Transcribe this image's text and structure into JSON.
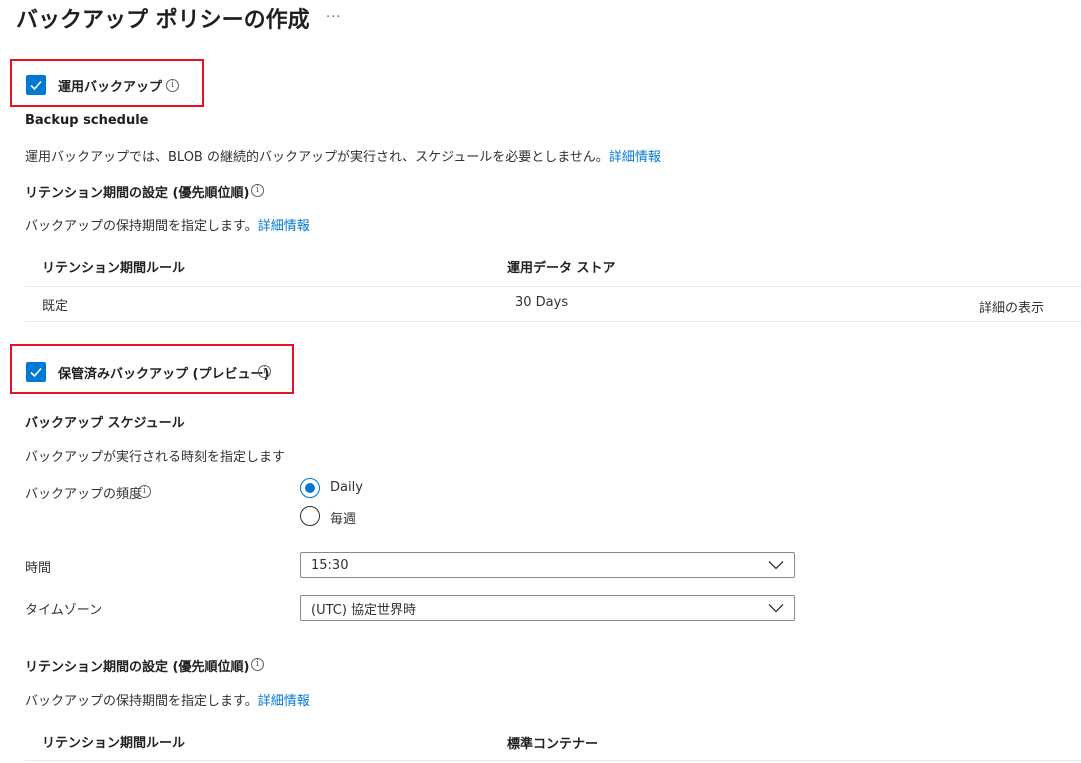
{
  "header": {
    "title": "バックアップ ポリシーの作成",
    "more_label": "···"
  },
  "operational": {
    "checkbox_label": "運用バックアップ",
    "checked": true,
    "schedule_heading": "Backup schedule",
    "schedule_desc": "運用バックアップでは、BLOB の継続的バックアップが実行され、スケジュールを必要としません。",
    "schedule_link": "詳細情報",
    "retention_heading": "リテンション期間の設定 (優先順位順)",
    "retention_desc": "バックアップの保持期間を指定します。",
    "retention_link": "詳細情報",
    "table": {
      "col_rule": "リテンション期間ルール",
      "col_store": "運用データ ストア",
      "rows": [
        {
          "rule": "既定",
          "store": "30 Days",
          "action": "詳細の表示"
        }
      ]
    }
  },
  "vaulted": {
    "checkbox_label": "保管済みバックアップ (プレビュー)",
    "checked": true,
    "schedule_heading": "バックアップ スケジュール",
    "schedule_desc": "バックアップが実行される時刻を指定します",
    "frequency_label": "バックアップの頻度",
    "frequency_options": [
      {
        "label": "Daily",
        "checked": true
      },
      {
        "label": "毎週",
        "checked": false
      }
    ],
    "time_label": "時間",
    "time_value": "15:30",
    "timezone_label": "タイムゾーン",
    "timezone_value": "(UTC) 協定世界時",
    "retention_heading": "リテンション期間の設定 (優先順位順)",
    "retention_desc": "バックアップの保持期間を指定します。",
    "retention_link": "詳細情報",
    "table": {
      "col_rule": "リテンション期間ルール",
      "col_store": "標準コンテナー"
    }
  },
  "colors": {
    "accent": "#0078d4",
    "highlight": "#e81123",
    "text": "#323130"
  },
  "icons": {
    "checkmark": "checkmark-icon",
    "info": "info-icon",
    "chevron": "chevron-down-icon"
  }
}
